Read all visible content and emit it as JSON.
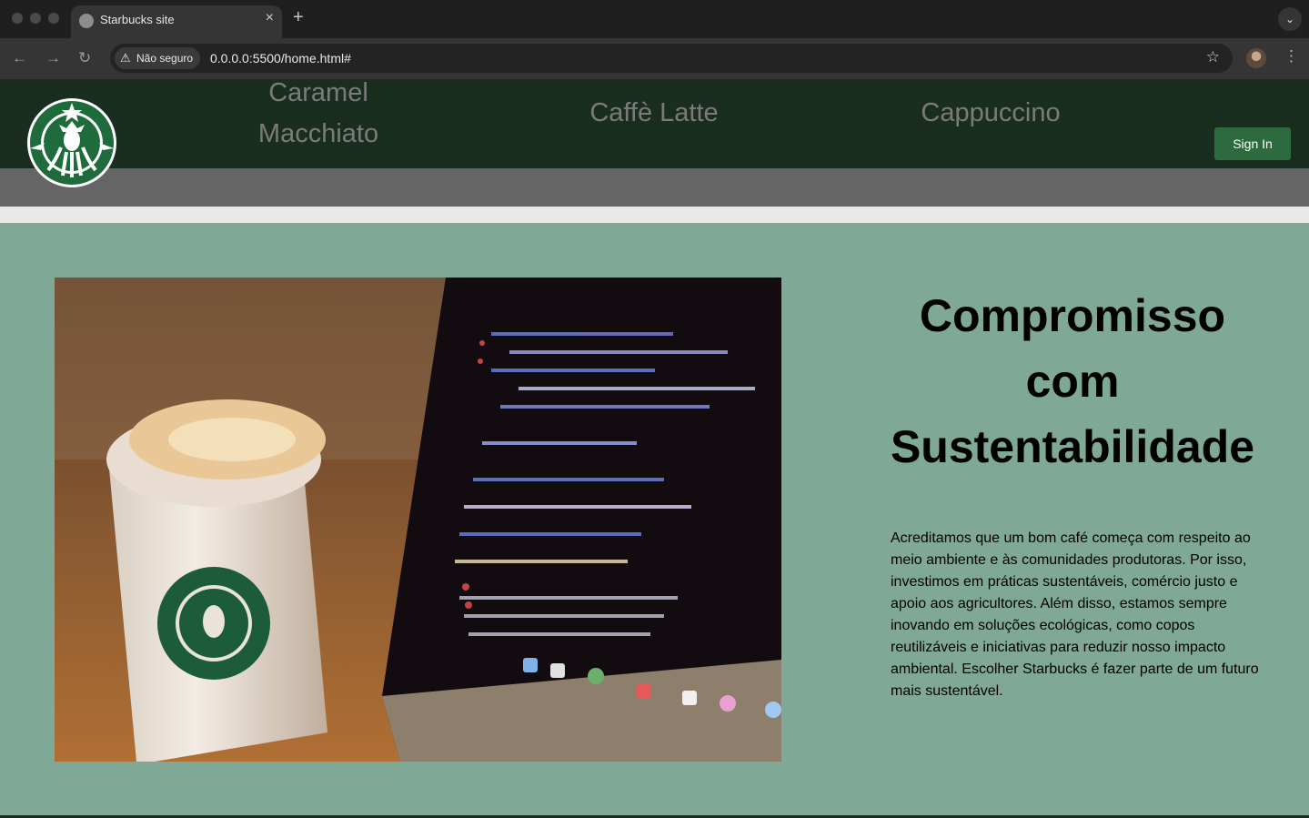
{
  "browser": {
    "tab_title": "Starbucks site",
    "security_label": "Não seguro",
    "url": "0.0.0.0:5500/home.html#"
  },
  "nav": {
    "items": [
      {
        "label": "Caramel Macchiato"
      },
      {
        "label": "Caffè Latte"
      },
      {
        "label": "Cappuccino"
      }
    ],
    "signin_label": "Sign In"
  },
  "main": {
    "heading": "Compromisso com Sustentabilidade",
    "paragraph": "Acreditamos que um bom café começa com respeito ao meio ambiente e às comunidades produtoras. Por isso, investimos em práticas sustentáveis, comércio justo e apoio aos agricultores. Além disso, estamos sempre inovando em soluções ecológicas, como copos reutilizáveis e iniciativas para reduzir nosso impacto ambiental. Escolher Starbucks é fazer parte de um futuro mais sustentável.",
    "image_icon": "coffee-cup-laptop-photo"
  },
  "colors": {
    "header": "#1a2e1f",
    "page_background": "#7fa896",
    "button": "#2d6a3e"
  }
}
